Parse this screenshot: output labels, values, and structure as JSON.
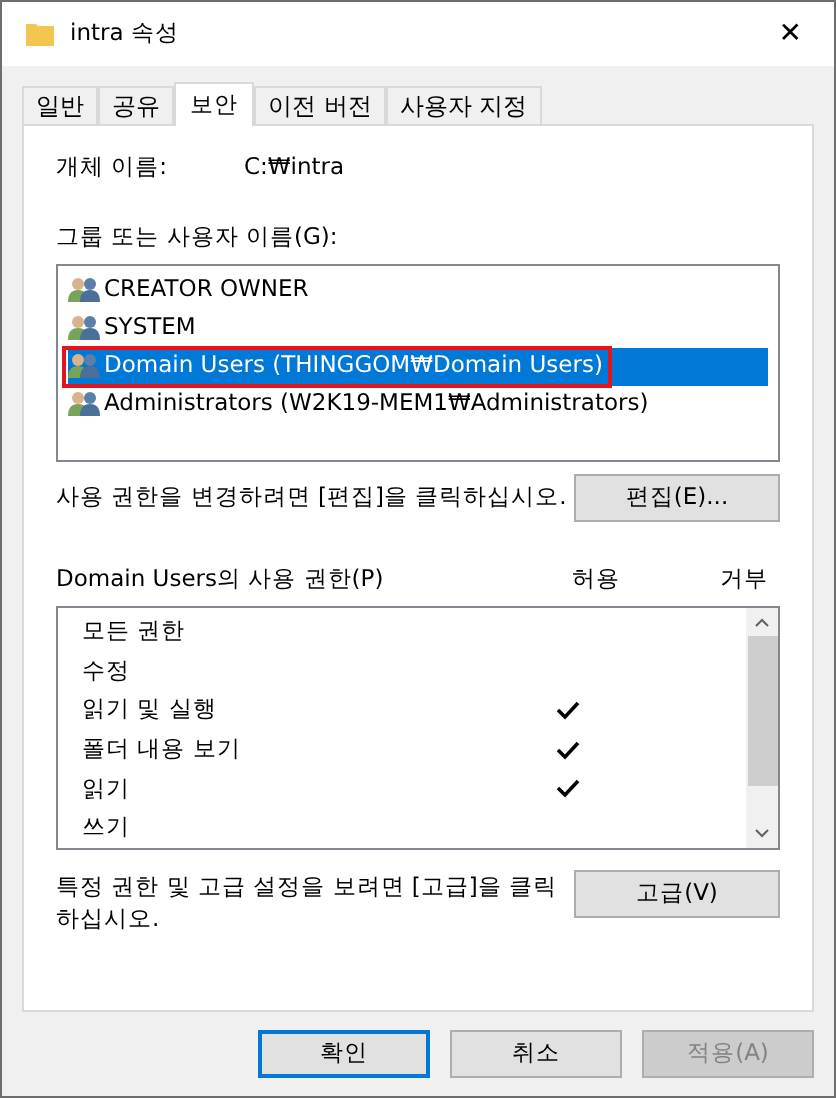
{
  "window": {
    "title": "intra 속성",
    "close": "✕"
  },
  "tabs": [
    {
      "label": "일반",
      "selected": false
    },
    {
      "label": "공유",
      "selected": false
    },
    {
      "label": "보안",
      "selected": true
    },
    {
      "label": "이전 버전",
      "selected": false
    },
    {
      "label": "사용자 지정",
      "selected": false
    }
  ],
  "object_name": {
    "label": "개체 이름:",
    "value": "C:₩intra"
  },
  "groups": {
    "label": "그룹 또는 사용자 이름(G):",
    "items": [
      {
        "name": "CREATOR OWNER",
        "selected": false,
        "annotated": false
      },
      {
        "name": "SYSTEM",
        "selected": false,
        "annotated": false
      },
      {
        "name": "Domain Users (THINGGOM₩Domain Users)",
        "selected": true,
        "annotated": true
      },
      {
        "name": "Administrators (W2K19-MEM1₩Administrators)",
        "selected": false,
        "annotated": false
      }
    ]
  },
  "edit_hint": "사용 권한을 변경하려면 [편집]을 클릭하십시오.",
  "edit_button": "편집(E)...",
  "permissions": {
    "label": "Domain Users의 사용 권한(P)",
    "allow_header": "허용",
    "deny_header": "거부",
    "rows": [
      {
        "name": "모든 권한",
        "allow": false,
        "deny": false
      },
      {
        "name": "수정",
        "allow": false,
        "deny": false
      },
      {
        "name": "읽기 및 실행",
        "allow": true,
        "deny": false
      },
      {
        "name": "폴더 내용 보기",
        "allow": true,
        "deny": false
      },
      {
        "name": "읽기",
        "allow": true,
        "deny": false
      },
      {
        "name": "쓰기",
        "allow": false,
        "deny": false
      }
    ]
  },
  "advanced_hint": "특정 권한 및 고급 설정을 보려면 [고급]을 클릭하십시오.",
  "advanced_button": "고급(V)",
  "buttons": [
    {
      "label": "확인",
      "default": true,
      "disabled": false
    },
    {
      "label": "취소",
      "default": false,
      "disabled": false
    },
    {
      "label": "적용(A)",
      "default": false,
      "disabled": true
    }
  ]
}
